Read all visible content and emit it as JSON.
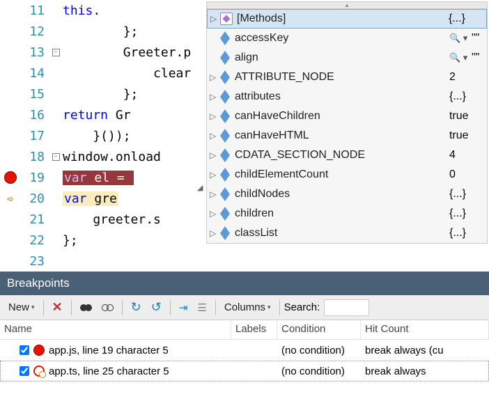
{
  "editor": {
    "lines": [
      {
        "num": 11,
        "html": "            <span class='kw'>this</span>."
      },
      {
        "num": 12,
        "html": "        };"
      },
      {
        "num": 13,
        "html": "        Greeter.p",
        "fold": "-"
      },
      {
        "num": 14,
        "html": "            clear"
      },
      {
        "num": 15,
        "html": "        };"
      },
      {
        "num": 16,
        "html": "        <span class='kw'>return</span> Gr"
      },
      {
        "num": 17,
        "html": "    }());"
      },
      {
        "num": 18,
        "html": "window.onload",
        "fold": "-"
      },
      {
        "num": 19,
        "html": "    <span class='hl-red'><span style='color:#d0c0ff'>var</span> el = </span>",
        "bp": true
      },
      {
        "num": 20,
        "html": "    <span class='hl-yellow'><span class='kw'>var</span> gre</span>",
        "arrow": true
      },
      {
        "num": 21,
        "html": "    greeter.s"
      },
      {
        "num": 22,
        "html": "};"
      },
      {
        "num": 23,
        "html": ""
      }
    ]
  },
  "intellisense": {
    "items": [
      {
        "icon": "method",
        "name": "[Methods]",
        "value": "{...}",
        "expand": true,
        "selected": true
      },
      {
        "icon": "prop",
        "name": "accessKey",
        "value": "\"\"",
        "mag": true
      },
      {
        "icon": "prop",
        "name": "align",
        "value": "\"\"",
        "mag": true
      },
      {
        "icon": "prop",
        "name": "ATTRIBUTE_NODE",
        "value": "2",
        "expand": true
      },
      {
        "icon": "prop",
        "name": "attributes",
        "value": "{...}",
        "expand": true
      },
      {
        "icon": "prop",
        "name": "canHaveChildren",
        "value": "true",
        "expand": true
      },
      {
        "icon": "prop",
        "name": "canHaveHTML",
        "value": "true",
        "expand": true
      },
      {
        "icon": "prop",
        "name": "CDATA_SECTION_NODE",
        "value": "4",
        "expand": true
      },
      {
        "icon": "prop",
        "name": "childElementCount",
        "value": "0",
        "expand": true
      },
      {
        "icon": "prop",
        "name": "childNodes",
        "value": "{...}",
        "expand": true
      },
      {
        "icon": "prop",
        "name": "children",
        "value": "{...}",
        "expand": true
      },
      {
        "icon": "prop",
        "name": "classList",
        "value": "{...}",
        "expand": true
      }
    ]
  },
  "breakpoints": {
    "title": "Breakpoints",
    "toolbar": {
      "new": "New",
      "columns": "Columns",
      "search": "Search:"
    },
    "columns": {
      "name": "Name",
      "labels": "Labels",
      "condition": "Condition",
      "hitcount": "Hit Count"
    },
    "rows": [
      {
        "icon": "js",
        "name": "app.js, line 19 character 5",
        "condition": "(no condition)",
        "hit": "break always (cu",
        "checked": true
      },
      {
        "icon": "ts",
        "name": "app.ts, line 25 character 5",
        "condition": "(no condition)",
        "hit": "break always",
        "checked": true,
        "selected": true
      }
    ]
  }
}
